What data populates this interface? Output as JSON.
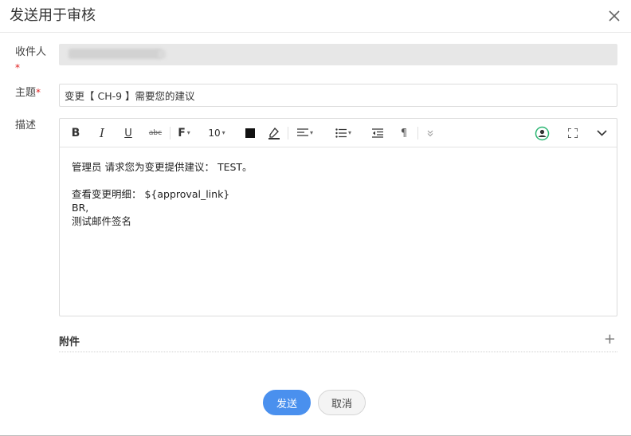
{
  "dialog": {
    "title": "发送用于审核",
    "close_icon": "close-icon"
  },
  "form": {
    "recipient_label": "收件人",
    "subject_label": "主题",
    "description_label": "描述",
    "required_mark": "*",
    "subject_value": "变更【 CH-9 】需要您的建议"
  },
  "toolbar": {
    "bold": "B",
    "italic": "I",
    "underline": "U",
    "strikethrough": "abc",
    "font_family": "F",
    "font_size": "10",
    "paragraph_mark": "¶",
    "icons": [
      "bold-icon",
      "italic-icon",
      "underline-icon",
      "strikethrough-icon",
      "font-family-icon",
      "font-size-select",
      "text-color-icon",
      "highlight-icon",
      "align-icon",
      "list-icon",
      "outdent-icon",
      "paragraph-icon",
      "more-icon",
      "user-mention-icon",
      "fullscreen-icon",
      "collapse-icon"
    ]
  },
  "body": {
    "line1": "管理员 请求您为变更提供建议： TEST。",
    "line2": "查看变更明细： ${approval_link}",
    "line3": "BR,",
    "line4": "测试邮件签名"
  },
  "attachments": {
    "label": "附件",
    "add": "+"
  },
  "buttons": {
    "send": "发送",
    "cancel": "取消"
  },
  "colors": {
    "primary": "#4a90ee",
    "required": "#e02020",
    "mention_icon": "#2bb673"
  }
}
